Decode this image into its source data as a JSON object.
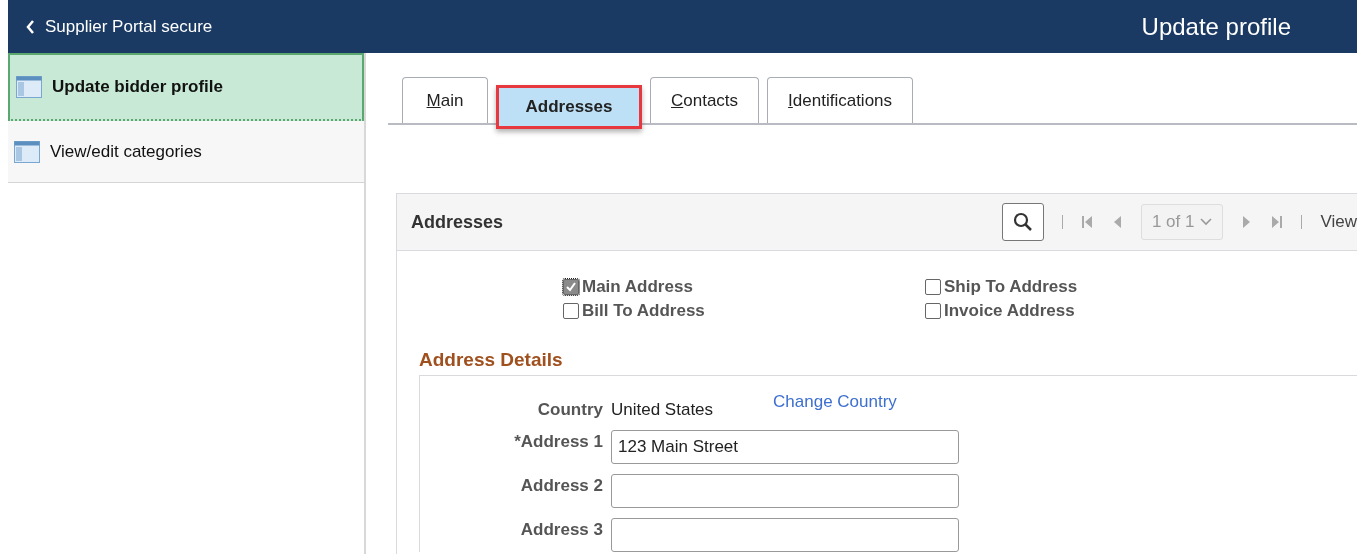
{
  "header": {
    "back_label": "Supplier Portal secure",
    "title": "Update profile"
  },
  "sidebar": {
    "items": [
      {
        "label": "Update bidder profile",
        "selected": true
      },
      {
        "label": "View/edit categories",
        "selected": false
      }
    ]
  },
  "tabs": [
    {
      "label": "Main",
      "first_letter_underlined": true,
      "selected": false
    },
    {
      "label": "Addresses",
      "first_letter_underlined": false,
      "selected": true
    },
    {
      "label": "Contacts",
      "first_letter_underlined": true,
      "selected": false
    },
    {
      "label": "Identifications",
      "first_letter_underlined": true,
      "selected": false
    }
  ],
  "panel": {
    "title": "Addresses",
    "pager": "1 of 1",
    "view_label": "View"
  },
  "address_types": [
    {
      "label": "Main Address",
      "checked": true
    },
    {
      "label": "Ship To Address",
      "checked": false
    },
    {
      "label": "Bill To Address",
      "checked": false
    },
    {
      "label": "Invoice Address",
      "checked": false
    }
  ],
  "details": {
    "heading": "Address Details",
    "country_label": "Country",
    "country_value": "United States",
    "change_link": "Change Country",
    "fields": [
      {
        "label": "*Address 1",
        "value": "123 Main Street"
      },
      {
        "label": "Address 2"
      },
      {
        "label": "Address 3"
      }
    ]
  }
}
